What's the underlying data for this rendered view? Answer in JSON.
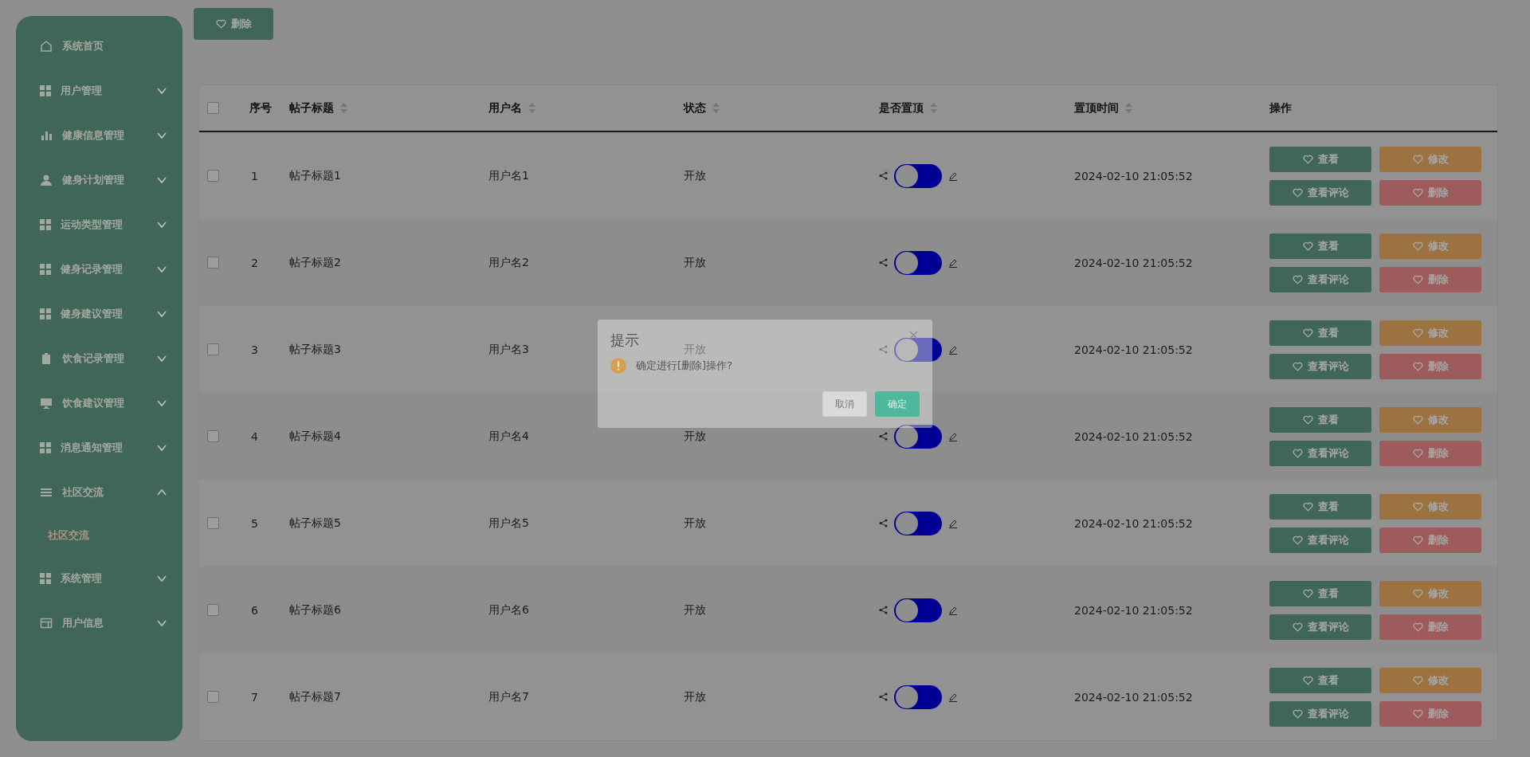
{
  "sidebar": {
    "items": [
      {
        "label": "系统首页"
      },
      {
        "label": "用户管理",
        "expanded": false
      },
      {
        "label": "健康信息管理",
        "expanded": false
      },
      {
        "label": "健身计划管理",
        "expanded": false
      },
      {
        "label": "运动类型管理",
        "expanded": false
      },
      {
        "label": "健身记录管理",
        "expanded": false
      },
      {
        "label": "健身建议管理",
        "expanded": false
      },
      {
        "label": "饮食记录管理",
        "expanded": false
      },
      {
        "label": "饮食建议管理",
        "expanded": false
      },
      {
        "label": "消息通知管理",
        "expanded": false
      },
      {
        "label": "社区交流",
        "expanded": true,
        "children": [
          {
            "label": "社区交流",
            "selected": true
          }
        ]
      },
      {
        "label": "系统管理",
        "expanded": false
      },
      {
        "label": "用户信息",
        "expanded": false
      }
    ]
  },
  "toolbar": {
    "buttons": [
      {
        "label": "删除",
        "kind": "primary"
      }
    ]
  },
  "table": {
    "select_all": {
      "checked": false
    },
    "columns": [
      {
        "label": "序号",
        "sortable": false
      },
      {
        "label": "帖子标题",
        "sortable": true
      },
      {
        "label": "用户名",
        "sortable": true
      },
      {
        "label": "状态",
        "sortable": true
      },
      {
        "label": "是否置顶",
        "sortable": true
      },
      {
        "label": "置顶时间",
        "sortable": true
      },
      {
        "label": "操作",
        "sortable": false
      }
    ],
    "rows": [
      {
        "checked": false,
        "index": "1",
        "title": "帖子标题1",
        "user": "用户名1",
        "status": "开放",
        "pinned": {
          "on": false
        },
        "time": "2024-02-10 21:05:52",
        "actions": [
          {
            "label": "查看",
            "kind": "view"
          },
          {
            "label": "修改",
            "kind": "edit"
          },
          {
            "label": "查看评论",
            "kind": "view"
          },
          {
            "label": "删除",
            "kind": "delete"
          }
        ]
      },
      {
        "checked": false,
        "index": "2",
        "title": "帖子标题2",
        "user": "用户名2",
        "status": "开放",
        "pinned": {
          "on": false
        },
        "time": "2024-02-10 21:05:52",
        "actions": [
          {
            "label": "查看",
            "kind": "view"
          },
          {
            "label": "修改",
            "kind": "edit"
          },
          {
            "label": "查看评论",
            "kind": "view"
          },
          {
            "label": "删除",
            "kind": "delete"
          }
        ]
      },
      {
        "checked": false,
        "index": "3",
        "title": "帖子标题3",
        "user": "用户名3",
        "status": "开放",
        "pinned": {
          "on": false
        },
        "time": "2024-02-10 21:05:52",
        "actions": [
          {
            "label": "查看",
            "kind": "view"
          },
          {
            "label": "修改",
            "kind": "edit"
          },
          {
            "label": "查看评论",
            "kind": "view"
          },
          {
            "label": "删除",
            "kind": "delete"
          }
        ]
      },
      {
        "checked": false,
        "index": "4",
        "title": "帖子标题4",
        "user": "用户名4",
        "status": "开放",
        "pinned": {
          "on": false
        },
        "time": "2024-02-10 21:05:52",
        "actions": [
          {
            "label": "查看",
            "kind": "view"
          },
          {
            "label": "修改",
            "kind": "edit"
          },
          {
            "label": "查看评论",
            "kind": "view"
          },
          {
            "label": "删除",
            "kind": "delete"
          }
        ]
      },
      {
        "checked": false,
        "index": "5",
        "title": "帖子标题5",
        "user": "用户名5",
        "status": "开放",
        "pinned": {
          "on": false
        },
        "time": "2024-02-10 21:05:52",
        "actions": [
          {
            "label": "查看",
            "kind": "view"
          },
          {
            "label": "修改",
            "kind": "edit"
          },
          {
            "label": "查看评论",
            "kind": "view"
          },
          {
            "label": "删除",
            "kind": "delete"
          }
        ]
      },
      {
        "checked": false,
        "index": "6",
        "title": "帖子标题6",
        "user": "用户名6",
        "status": "开放",
        "pinned": {
          "on": false
        },
        "time": "2024-02-10 21:05:52",
        "actions": [
          {
            "label": "查看",
            "kind": "view"
          },
          {
            "label": "修改",
            "kind": "edit"
          },
          {
            "label": "查看评论",
            "kind": "view"
          },
          {
            "label": "删除",
            "kind": "delete"
          }
        ]
      },
      {
        "checked": false,
        "index": "7",
        "title": "帖子标题7",
        "user": "用户名7",
        "status": "开放",
        "pinned": {
          "on": false
        },
        "time": "2024-02-10 21:05:52",
        "actions": [
          {
            "label": "查看",
            "kind": "view"
          },
          {
            "label": "修改",
            "kind": "edit"
          },
          {
            "label": "查看评论",
            "kind": "view"
          },
          {
            "label": "删除",
            "kind": "delete"
          }
        ]
      }
    ]
  },
  "dialog": {
    "title": "提示",
    "message": "确定进行[删除]操作?",
    "buttons": [
      {
        "label": "取消",
        "kind": "cancel"
      },
      {
        "label": "确定",
        "kind": "confirm"
      }
    ]
  }
}
